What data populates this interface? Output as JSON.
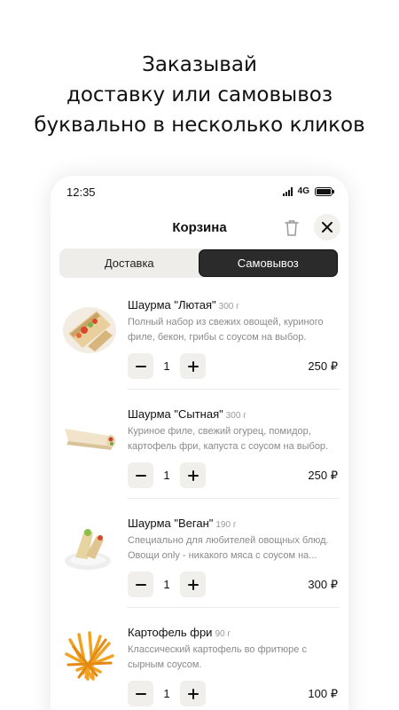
{
  "promo": {
    "line1": "Заказывай",
    "line2": "доставку или самовывоз",
    "line3": "буквально в несколько кликов"
  },
  "status_bar": {
    "time": "12:35",
    "network": "4G"
  },
  "header": {
    "title": "Корзина",
    "icons": [
      "trash-icon",
      "close-icon"
    ]
  },
  "tabs": [
    {
      "label": "Доставка",
      "active": false
    },
    {
      "label": "Самовывоз",
      "active": true
    }
  ],
  "cart": {
    "items": [
      {
        "name": "Шаурма \"Лютая\"",
        "weight": "300 г",
        "description": "Полный набор из свежих овощей, куриного филе, бекон, грибы с соусом на выбор.",
        "quantity": "1",
        "price": "250 ₽"
      },
      {
        "name": "Шаурма \"Сытная\"",
        "weight": "300 г",
        "description": "Куриное филе, свежий огурец, помидор, картофель фри, капуста с соусом на выбор.",
        "quantity": "1",
        "price": "250 ₽"
      },
      {
        "name": "Шаурма \"Веган\"",
        "weight": "190 г",
        "description": "Специально для любителей овощных блюд. Овощи only - никакого мяса с соусом на...",
        "quantity": "1",
        "price": "300 ₽"
      },
      {
        "name": "Картофель фри",
        "weight": "90 г",
        "description": "Классический картофель во фритюре с сырным соусом.",
        "quantity": "1",
        "price": "100 ₽"
      }
    ]
  }
}
